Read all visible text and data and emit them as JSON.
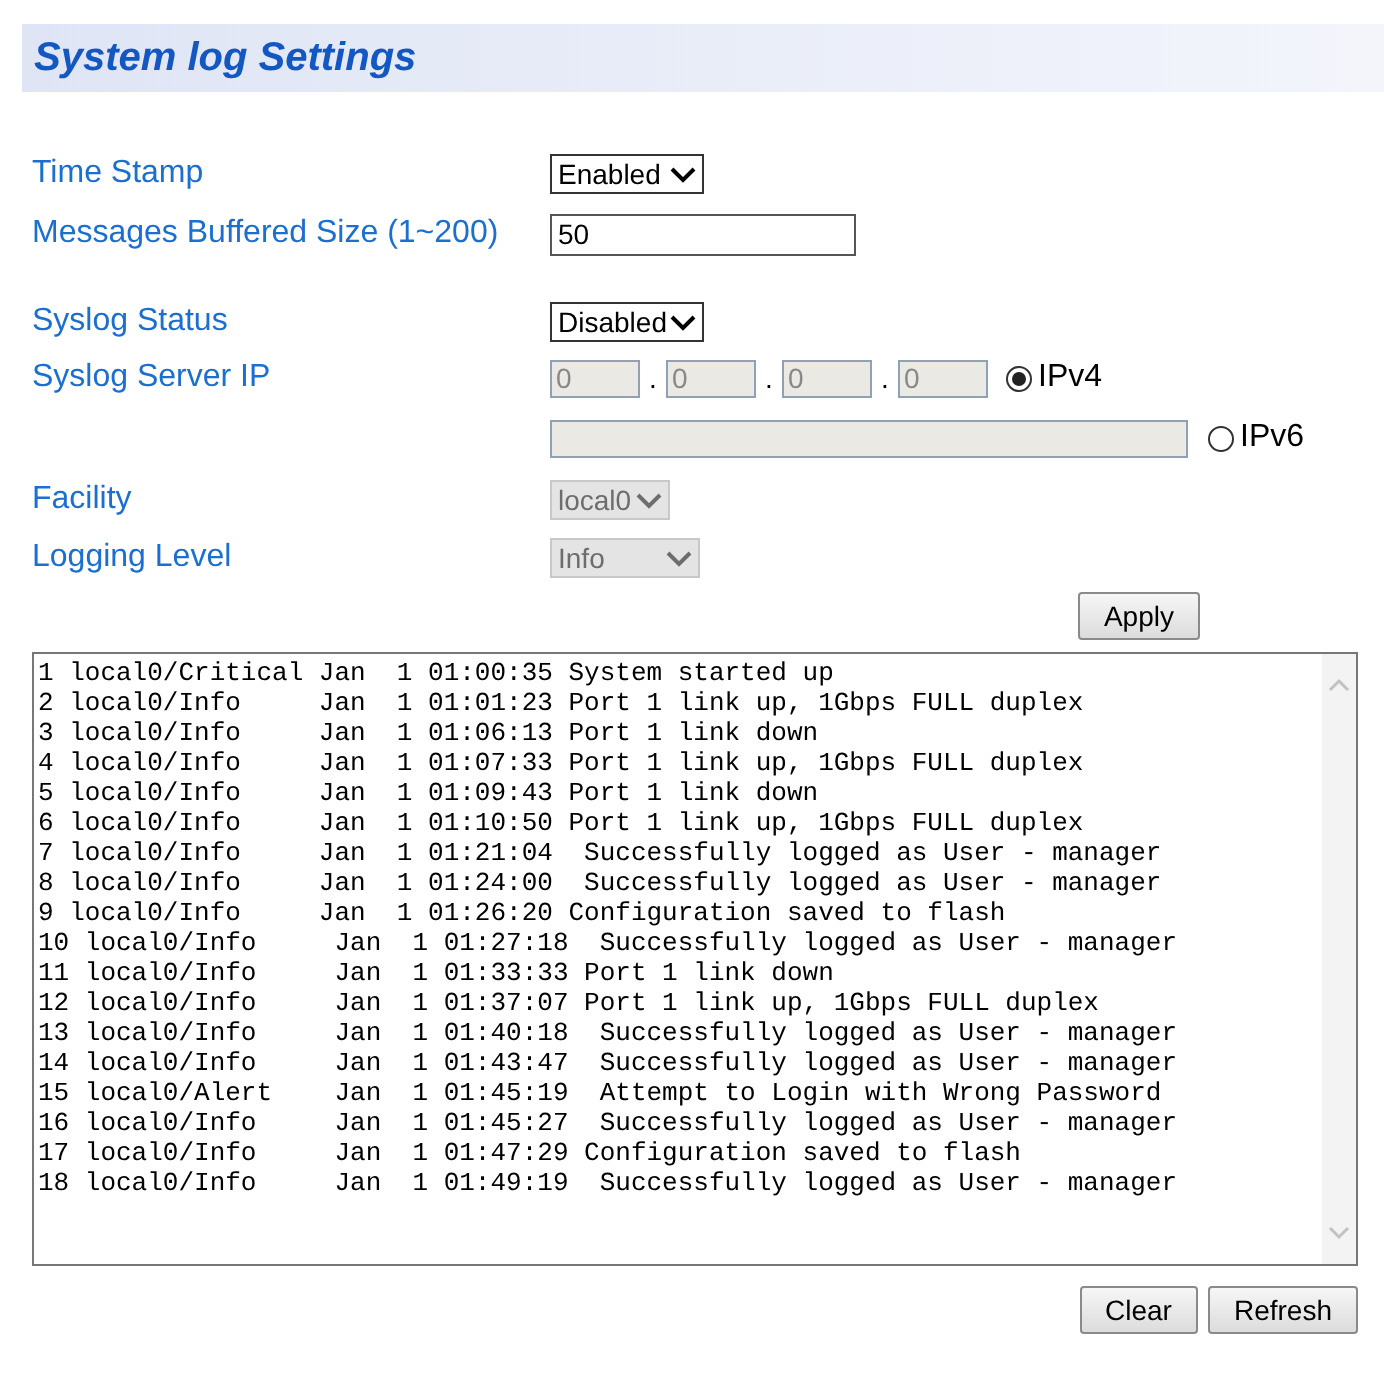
{
  "title": "System log Settings",
  "time_stamp": {
    "label": "Time Stamp",
    "value": "Enabled",
    "disabled": false
  },
  "buffer_size": {
    "label": "Messages Buffered Size (1~200)",
    "value": "50"
  },
  "syslog_status": {
    "label": "Syslog Status",
    "value": "Disabled",
    "disabled": false
  },
  "server_ip": {
    "label": "Syslog Server IP",
    "octets": [
      {
        "value": "0",
        "disabled": true
      },
      {
        "value": "0",
        "disabled": true
      },
      {
        "value": "0",
        "disabled": true
      },
      {
        "value": "0",
        "disabled": true
      }
    ],
    "separators": [
      ".",
      ".",
      "."
    ],
    "ipv4": {
      "label": "IPv4",
      "selected": true
    },
    "ipv6_field": {
      "disabled": true
    },
    "ipv6": {
      "label": "IPv6",
      "selected": false
    }
  },
  "facility": {
    "label": "Facility",
    "value": "local0",
    "disabled": true
  },
  "logging_level": {
    "label": "Logging Level",
    "value": "Info",
    "disabled": true
  },
  "apply_button": "Apply",
  "log_lines": [
    "1 local0/Critical Jan  1 01:00:35 System started up",
    "2 local0/Info     Jan  1 01:01:23 Port 1 link up, 1Gbps FULL duplex",
    "3 local0/Info     Jan  1 01:06:13 Port 1 link down",
    "4 local0/Info     Jan  1 01:07:33 Port 1 link up, 1Gbps FULL duplex",
    "5 local0/Info     Jan  1 01:09:43 Port 1 link down",
    "6 local0/Info     Jan  1 01:10:50 Port 1 link up, 1Gbps FULL duplex",
    "7 local0/Info     Jan  1 01:21:04  Successfully logged as User - manager",
    "8 local0/Info     Jan  1 01:24:00  Successfully logged as User - manager",
    "9 local0/Info     Jan  1 01:26:20 Configuration saved to flash",
    "10 local0/Info     Jan  1 01:27:18  Successfully logged as User - manager",
    "11 local0/Info     Jan  1 01:33:33 Port 1 link down",
    "12 local0/Info     Jan  1 01:37:07 Port 1 link up, 1Gbps FULL duplex",
    "13 local0/Info     Jan  1 01:40:18  Successfully logged as User - manager",
    "14 local0/Info     Jan  1 01:43:47  Successfully logged as User - manager",
    "15 local0/Alert    Jan  1 01:45:19  Attempt to Login with Wrong Password",
    "16 local0/Info     Jan  1 01:45:27  Successfully logged as User - manager",
    "17 local0/Info     Jan  1 01:47:29 Configuration saved to flash",
    "18 local0/Info     Jan  1 01:49:19  Successfully logged as User - manager"
  ],
  "buttons": [
    "Clear",
    "Refresh"
  ]
}
